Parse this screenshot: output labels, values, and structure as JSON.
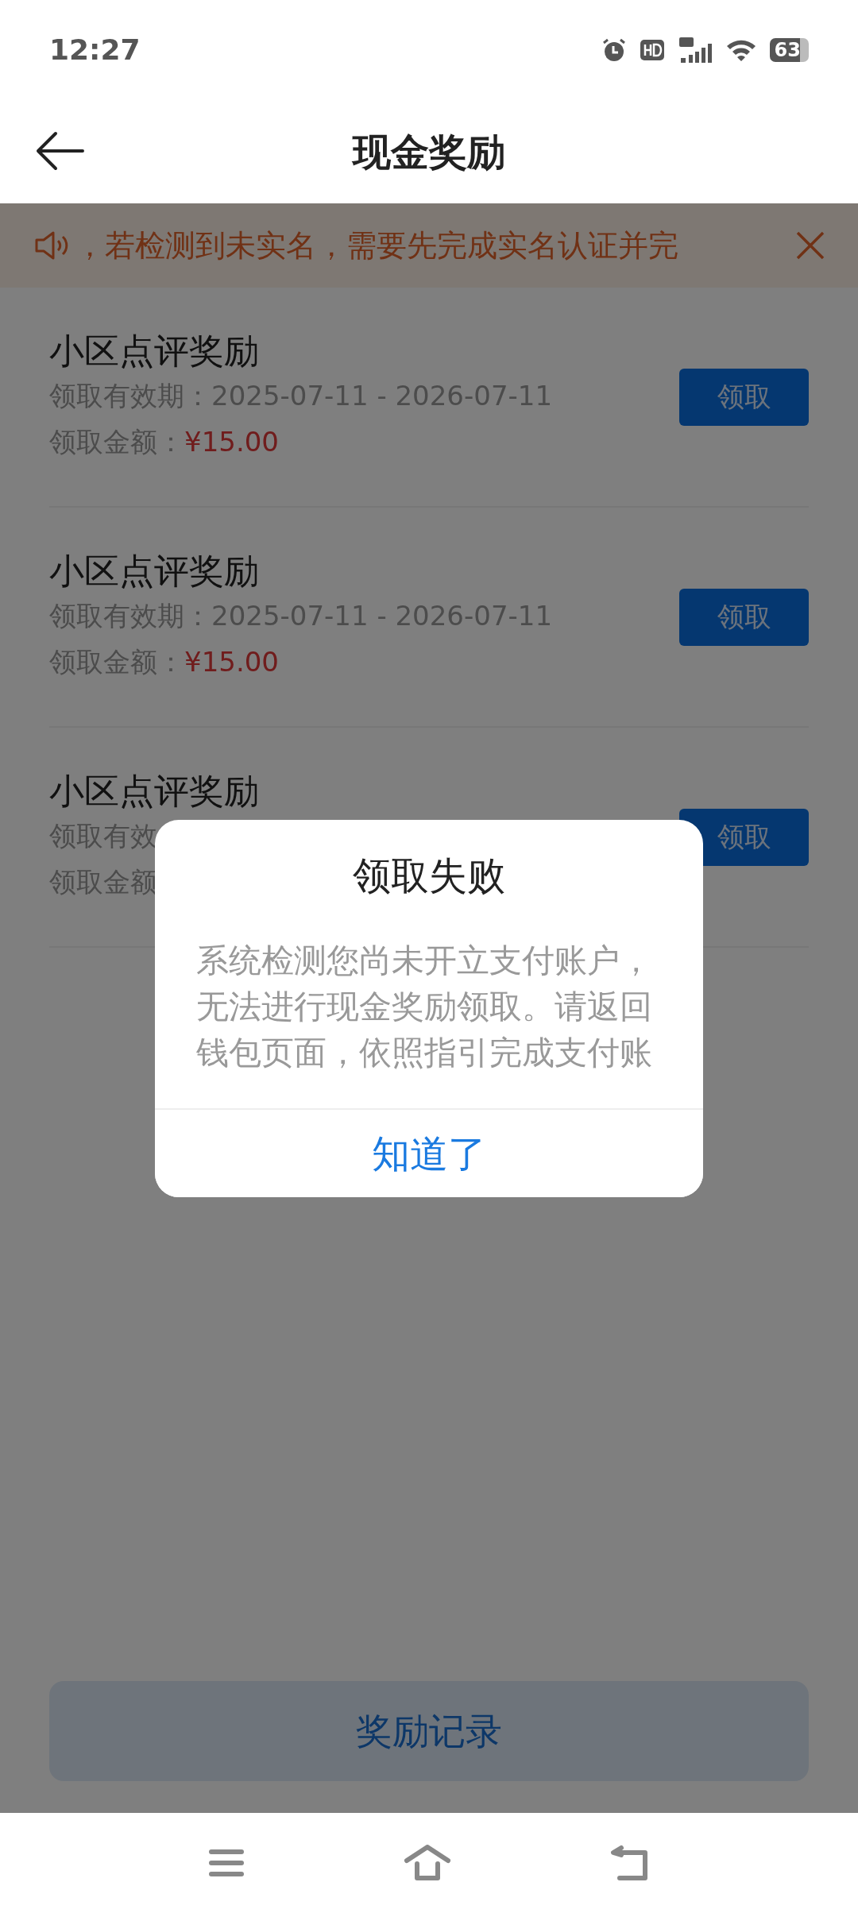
{
  "status_bar": {
    "time": "12:27",
    "battery": "63"
  },
  "header": {
    "title": "现金奖励"
  },
  "notice": {
    "text": "，若检测到未实名，需要先完成实名认证并完"
  },
  "rewards": [
    {
      "title": "小区点评奖励",
      "validity_label": "领取有效期：",
      "validity": "2025-07-11 - 2026-07-11",
      "amount_label": "领取金额：",
      "amount": "¥15.00",
      "button": "领取"
    },
    {
      "title": "小区点评奖励",
      "validity_label": "领取有效期：",
      "validity": "2025-07-11 - 2026-07-11",
      "amount_label": "领取金额：",
      "amount": "¥15.00",
      "button": "领取"
    },
    {
      "title": "小区点评奖励",
      "validity_label": "领取有效",
      "amount_label": "领取金额",
      "button": "领取"
    }
  ],
  "footer_button": "奖励记录",
  "dialog": {
    "title": "领取失败",
    "lines": [
      "系统检测您尚未开立支付账户，",
      "无法进行现金奖励领取。请返回",
      "钱包页面，依照指引完成支付账"
    ],
    "button": "知道了"
  }
}
